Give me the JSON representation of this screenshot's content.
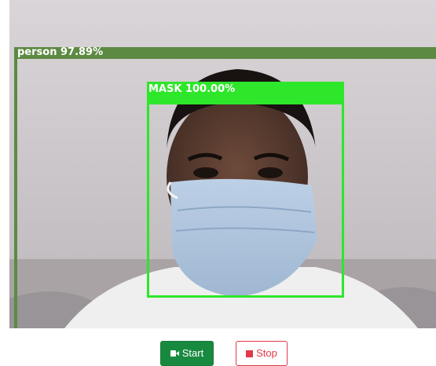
{
  "video": {
    "detections": [
      {
        "label": "person 97.89%",
        "color": "#5d8a43"
      },
      {
        "label": "MASK 100.00%",
        "color": "#2ee62a"
      }
    ]
  },
  "controls": {
    "start_label": "Start",
    "start_icon": "video-camera-icon",
    "start_color": "#188a40",
    "stop_label": "Stop",
    "stop_icon": "stop-square-icon",
    "stop_color": "#e0394a"
  }
}
